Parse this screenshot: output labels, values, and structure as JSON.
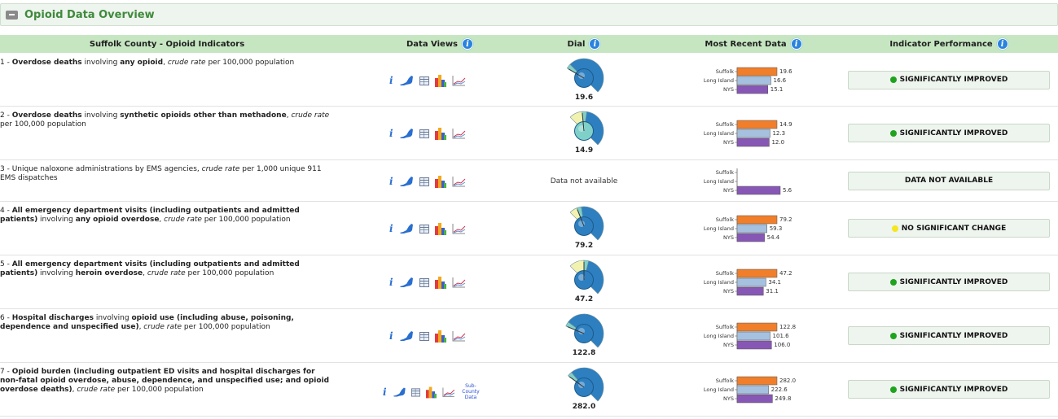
{
  "panel": {
    "title": "Opioid Data Overview"
  },
  "header": {
    "indicator_col": "Suffolk County - Opioid Indicators",
    "views_col": "Data Views",
    "dial_col": "Dial",
    "recent_col": "Most Recent Data",
    "perf_col": "Indicator Performance",
    "info_glyph": "i"
  },
  "icons": {
    "info": "i",
    "map": "ny-state-map-icon",
    "table": "table-icon",
    "bar": "bar-chart-icon",
    "trend": "trend-line-icon",
    "subcounty": "Sub-County Data"
  },
  "bar_labels": [
    "Suffolk",
    "Long Island",
    "NYS"
  ],
  "colors": {
    "suffolk": "#f07e2a",
    "long_island": "#a6c1e0",
    "nys": "#8757b5",
    "improved": "#1fa31f",
    "no_change": "#f5e61e",
    "dial_blue": "#2d7fc0",
    "dial_teal": "#7fd0c8",
    "dial_yellow": "#f2f2b0"
  },
  "rows": [
    {
      "desc_segments": [
        {
          "t": "1 - ",
          "s": ""
        },
        {
          "t": "Overdose deaths",
          "s": "b"
        },
        {
          "t": " involving ",
          "s": ""
        },
        {
          "t": "any opioid",
          "s": "b"
        },
        {
          "t": ", ",
          "s": ""
        },
        {
          "t": "crude rate",
          "s": "i"
        },
        {
          "t": " per 100,000 population",
          "s": ""
        }
      ],
      "dial_value": "19.6",
      "dial_level": 0.28,
      "dial_center": "blue",
      "bars": [
        19.6,
        16.6,
        15.1
      ],
      "bar_text": [
        "19.6",
        "16.6",
        "15.1"
      ],
      "performance": "SIGNIFICANTLY IMPROVED",
      "perf_status": "improved",
      "subcounty": false
    },
    {
      "desc_segments": [
        {
          "t": "2 - ",
          "s": ""
        },
        {
          "t": "Overdose deaths",
          "s": "b"
        },
        {
          "t": " involving ",
          "s": ""
        },
        {
          "t": "synthetic opioids other than methadone",
          "s": "b"
        },
        {
          "t": ", ",
          "s": ""
        },
        {
          "t": "crude rate",
          "s": "i"
        },
        {
          "t": " per 100,000 population",
          "s": ""
        }
      ],
      "dial_value": "14.9",
      "dial_level": 0.48,
      "dial_center": "teal",
      "bars": [
        14.9,
        12.3,
        12.0
      ],
      "bar_text": [
        "14.9",
        "12.3",
        "12.0"
      ],
      "performance": "SIGNIFICANTLY IMPROVED",
      "perf_status": "improved",
      "subcounty": false
    },
    {
      "desc_segments": [
        {
          "t": "3 - Unique naloxone administrations by EMS agencies, ",
          "s": ""
        },
        {
          "t": "crude rate",
          "s": "i"
        },
        {
          "t": " per 1,000 unique 911 EMS dispatches",
          "s": ""
        }
      ],
      "dial_value": null,
      "no_data_text": "Data not available",
      "bars": [
        null,
        null,
        5.6
      ],
      "bar_text": [
        "",
        "",
        "5.6"
      ],
      "performance": "DATA NOT AVAILABLE",
      "perf_status": "none",
      "subcounty": false
    },
    {
      "desc_segments": [
        {
          "t": "4 - ",
          "s": ""
        },
        {
          "t": "All emergency department visits (including outpatients and admitted patients)",
          "s": "b"
        },
        {
          "t": " involving ",
          "s": ""
        },
        {
          "t": "any opioid overdose",
          "s": "b"
        },
        {
          "t": ", ",
          "s": ""
        },
        {
          "t": "crude rate",
          "s": "i"
        },
        {
          "t": " per 100,000 population",
          "s": ""
        }
      ],
      "dial_value": "79.2",
      "dial_level": 0.42,
      "dial_center": "blue",
      "bars": [
        79.2,
        59.3,
        54.4
      ],
      "bar_text": [
        "79.2",
        "59.3",
        "54.4"
      ],
      "performance": "NO SIGNIFICANT CHANGE",
      "perf_status": "no_change",
      "subcounty": false
    },
    {
      "desc_segments": [
        {
          "t": "5 - ",
          "s": ""
        },
        {
          "t": "All emergency department visits (including outpatients and admitted patients)",
          "s": "b"
        },
        {
          "t": " involving ",
          "s": ""
        },
        {
          "t": "heroin overdose",
          "s": "b"
        },
        {
          "t": ", ",
          "s": ""
        },
        {
          "t": "crude rate",
          "s": "i"
        },
        {
          "t": " per 100,000 population",
          "s": ""
        }
      ],
      "dial_value": "47.2",
      "dial_level": 0.5,
      "dial_center": "blue",
      "bars": [
        47.2,
        34.1,
        31.1
      ],
      "bar_text": [
        "47.2",
        "34.1",
        "31.1"
      ],
      "performance": "SIGNIFICANTLY IMPROVED",
      "perf_status": "improved",
      "subcounty": false
    },
    {
      "desc_segments": [
        {
          "t": "6 - ",
          "s": ""
        },
        {
          "t": "Hospital discharges",
          "s": "b"
        },
        {
          "t": " involving ",
          "s": ""
        },
        {
          "t": "opioid use (including abuse, poisoning, dependence and unspecified use)",
          "s": "b"
        },
        {
          "t": ", ",
          "s": ""
        },
        {
          "t": "crude rate",
          "s": "i"
        },
        {
          "t": " per 100,000 population",
          "s": ""
        }
      ],
      "dial_value": "122.8",
      "dial_level": 0.25,
      "dial_center": "blue",
      "bars": [
        122.8,
        101.6,
        106.0
      ],
      "bar_text": [
        "122.8",
        "101.6",
        "106.0"
      ],
      "performance": "SIGNIFICANTLY IMPROVED",
      "perf_status": "improved",
      "subcounty": false
    },
    {
      "desc_segments": [
        {
          "t": "7 - ",
          "s": ""
        },
        {
          "t": "Opioid burden (including outpatient ED visits and hospital discharges for non-fatal opioid overdose, abuse, dependence, and unspecified use; and opioid overdose deaths)",
          "s": "b"
        },
        {
          "t": ", ",
          "s": ""
        },
        {
          "t": "crude rate",
          "s": "i"
        },
        {
          "t": " per 100,000 population",
          "s": ""
        }
      ],
      "dial_value": "282.0",
      "dial_level": 0.3,
      "dial_center": "blue",
      "bars": [
        282.0,
        222.6,
        249.8
      ],
      "bar_text": [
        "282.0",
        "222.6",
        "249.8"
      ],
      "performance": "SIGNIFICANTLY IMPROVED",
      "perf_status": "improved",
      "subcounty": true
    }
  ]
}
